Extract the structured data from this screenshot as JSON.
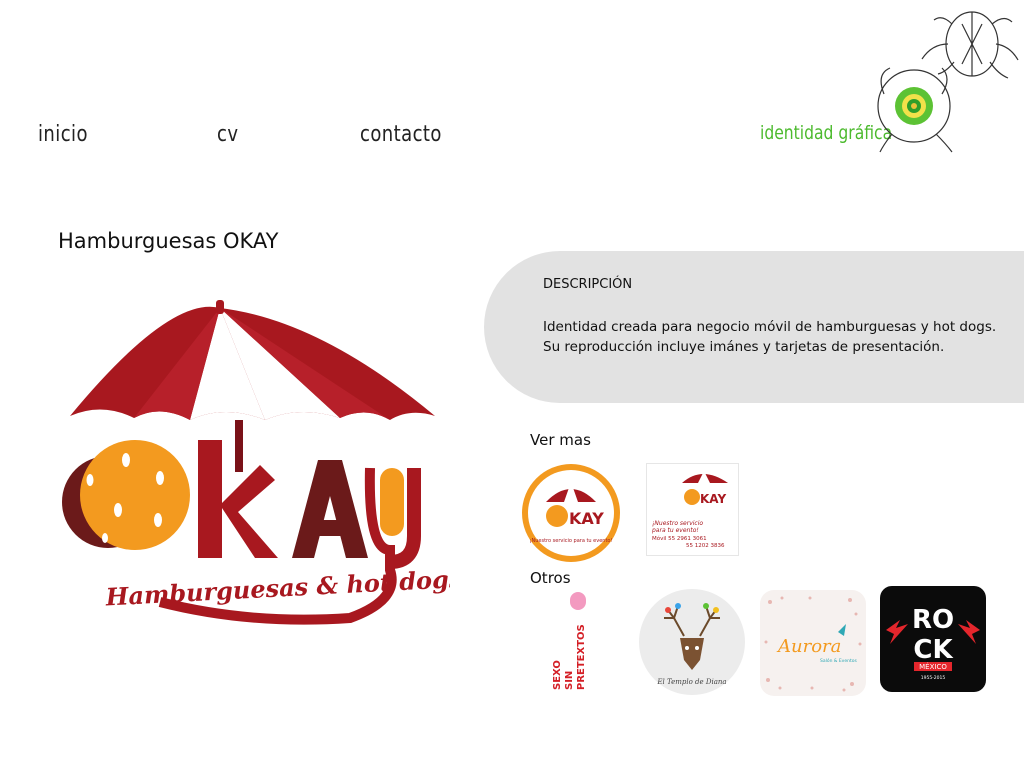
{
  "nav": {
    "items": [
      {
        "label": "inicio"
      },
      {
        "label": "cv"
      },
      {
        "label": "contacto"
      }
    ],
    "brand": "identidad gráfica"
  },
  "project": {
    "title": "Hamburguesas OKAY",
    "logo_word": "OKAY",
    "logo_tagline": "Hamburguesas & hot dogs"
  },
  "description": {
    "heading": "DESCRIPCIÓN",
    "lines": [
      "Identidad creada para negocio móvil de hamburguesas y hot dogs.",
      "Su reproducción incluye imánes y tarjetas de presentación."
    ]
  },
  "ver_mas": {
    "label": "Ver mas",
    "items": [
      {
        "name": "okay-magnet-thumbnail",
        "text": "¡Nuestro servicio para tu evento!"
      },
      {
        "name": "okay-card-thumbnail",
        "text_lines": [
          "¡Nuestro servicio",
          "para tu evento!",
          "Móvil  55 2961 3061",
          "55 1202 3836"
        ]
      }
    ]
  },
  "otros": {
    "label": "Otros",
    "items": [
      {
        "name": "sexo-sin-pretextos-thumbnail",
        "lines": [
          "SEXO",
          "SIN",
          "PRETEXTOS"
        ]
      },
      {
        "name": "el-templo-de-diana-thumbnail",
        "text": "El Templo de Diana"
      },
      {
        "name": "aurora-thumbnail",
        "text": "Aurora",
        "sub": "Salón & Eventos"
      },
      {
        "name": "rock-mexico-thumbnail",
        "lines": [
          "RO",
          "CK"
        ],
        "sub": "MÉXICO",
        "years": "1955-2015"
      }
    ]
  },
  "colors": {
    "brand_green": "#4cba2e",
    "okay_red": "#a8181f",
    "okay_orange": "#f39a1f",
    "panel_gray": "#e2e2e2"
  }
}
